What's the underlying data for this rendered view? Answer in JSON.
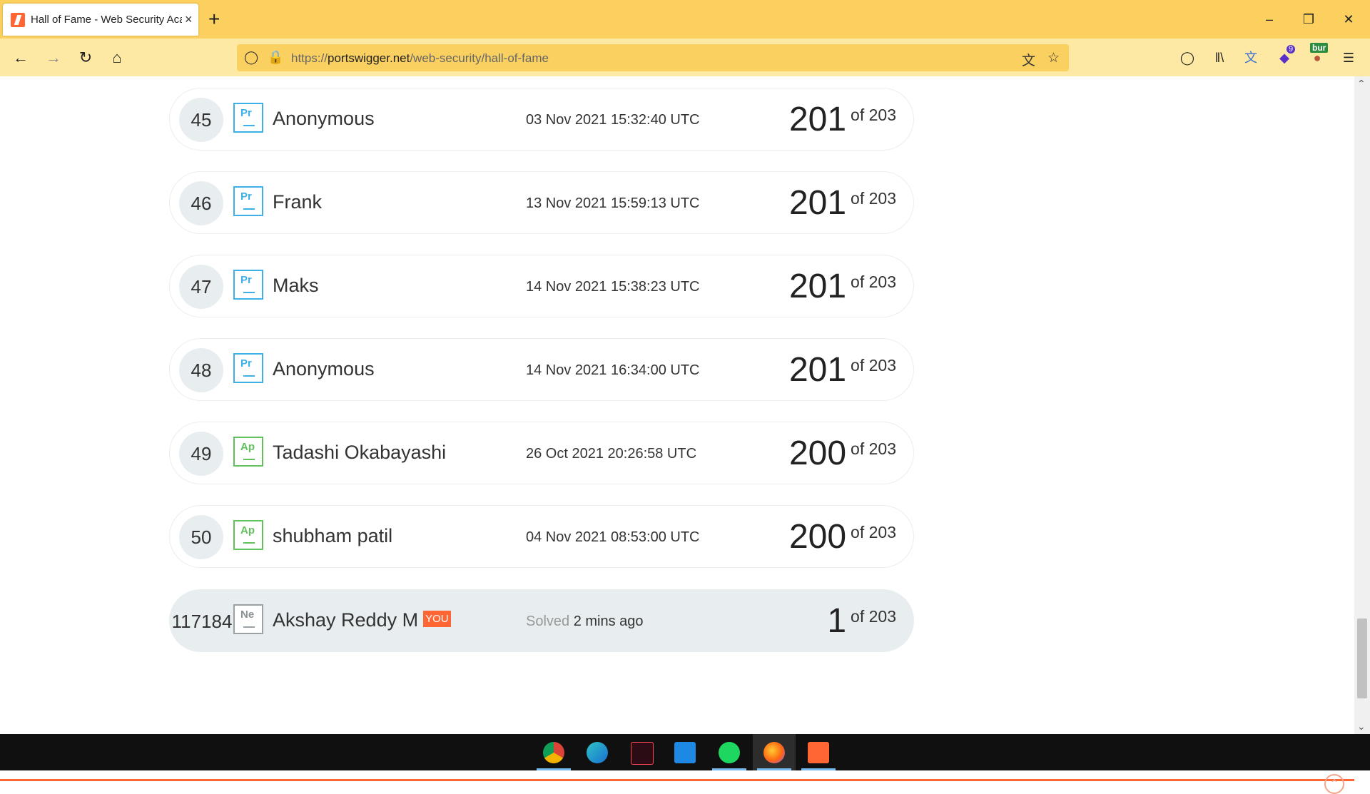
{
  "browser": {
    "tab_title": "Hall of Fame - Web Security Acade",
    "tab_close": "×",
    "new_tab": "+",
    "url_scheme": "https://",
    "url_host": "portswigger.net",
    "url_path": "/web-security/hall-of-fame",
    "extension_badge": "bur",
    "extension_count": "9"
  },
  "leaderboard": [
    {
      "rank": "45",
      "level": "Pr",
      "name": "Anonymous",
      "date": "03 Nov 2021 15:32:40 UTC",
      "score": "201",
      "total": "of 203"
    },
    {
      "rank": "46",
      "level": "Pr",
      "name": "Frank",
      "date": "13 Nov 2021 15:59:13 UTC",
      "score": "201",
      "total": "of 203"
    },
    {
      "rank": "47",
      "level": "Pr",
      "name": "Maks",
      "date": "14 Nov 2021 15:38:23 UTC",
      "score": "201",
      "total": "of 203"
    },
    {
      "rank": "48",
      "level": "Pr",
      "name": "Anonymous",
      "date": "14 Nov 2021 16:34:00 UTC",
      "score": "201",
      "total": "of 203"
    },
    {
      "rank": "49",
      "level": "Ap",
      "name": "Tadashi Okabayashi",
      "date": "26 Oct 2021 20:26:58 UTC",
      "score": "200",
      "total": "of 203"
    },
    {
      "rank": "50",
      "level": "Ap",
      "name": "shubham patil",
      "date": "04 Nov 2021 08:53:00 UTC",
      "score": "200",
      "total": "of 203"
    }
  ],
  "current_user": {
    "rank": "117184",
    "level": "Ne",
    "name": "Akshay Reddy M",
    "badge": "YOU",
    "solved_label": "Solved",
    "solved_time": "2 mins ago",
    "score": "1",
    "total": "of 203"
  },
  "colors": {
    "accent": "#ff6633",
    "practitioner": "#3db0e8",
    "apprentice": "#62c15d",
    "tabbar": "#fcd05f"
  }
}
